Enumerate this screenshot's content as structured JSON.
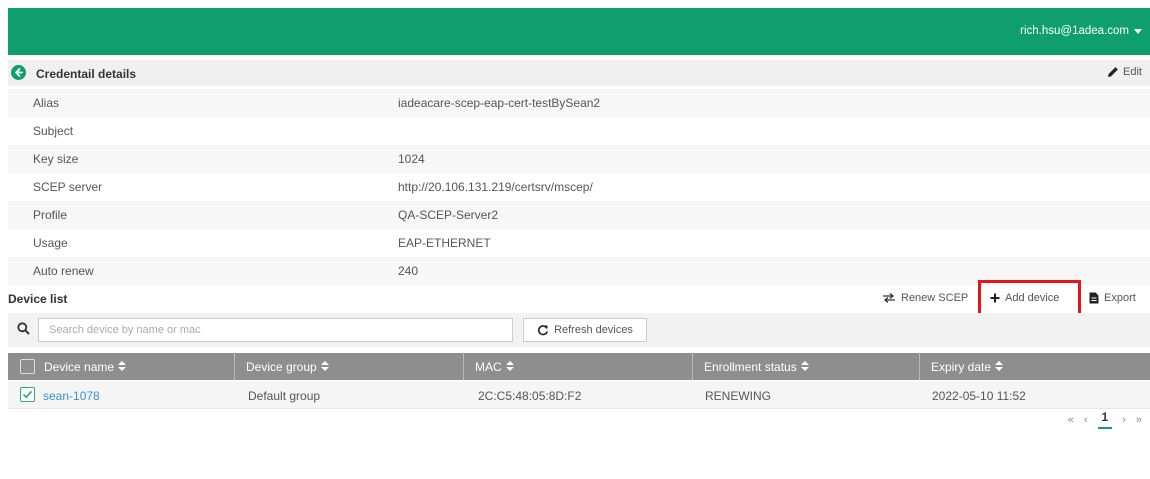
{
  "header": {
    "user_email": "rich.hsu@1adea.com",
    "brand_color": "#0f9f6e"
  },
  "details": {
    "title": "Credentail details",
    "edit_label": "Edit",
    "rows": [
      {
        "label": "Alias",
        "value": "iadeacare-scep-eap-cert-testBySean2"
      },
      {
        "label": "Subject",
        "value": ""
      },
      {
        "label": "Key size",
        "value": "1024"
      },
      {
        "label": "SCEP server",
        "value": "http://20.106.131.219/certsrv/mscep/"
      },
      {
        "label": "Profile",
        "value": "QA-SCEP-Server2"
      },
      {
        "label": "Usage",
        "value": "EAP-ETHERNET"
      },
      {
        "label": "Auto renew",
        "value": "240"
      }
    ]
  },
  "device_list": {
    "title": "Device list",
    "actions": {
      "renew": "Renew SCEP",
      "add": "Add device",
      "export": "Export"
    },
    "search_placeholder": "Search device by name or mac",
    "refresh_label": "Refresh devices",
    "columns": [
      "Device name",
      "Device group",
      "MAC",
      "Enrollment status",
      "Expiry date"
    ],
    "rows": [
      {
        "name": "sean-1078",
        "group": "Default group",
        "mac": "2C:C5:48:05:8D:F2",
        "status": "RENEWING",
        "expiry": "2022-05-10 11:52",
        "checked": true
      }
    ],
    "pagination": {
      "first": "«",
      "prev": "‹",
      "page": "1",
      "next": "›",
      "last": "»"
    }
  },
  "icons": [
    "back-arrow-icon",
    "pencil-icon",
    "renew-icon",
    "plus-icon",
    "export-file-icon",
    "search-icon",
    "refresh-icon",
    "sort-icon",
    "checkbox-icon",
    "caret-down-icon"
  ]
}
